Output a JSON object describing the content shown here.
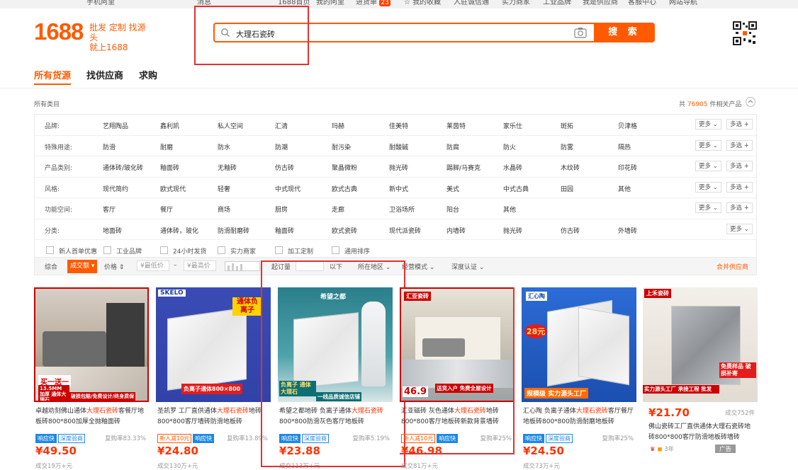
{
  "topbar": {
    "items": [
      "手机阿里",
      "消息",
      "1688首页",
      "我的阿里",
      "进货单",
      "我的收藏",
      "入驻诚信通",
      "实力商家",
      "工业品牌",
      "我是供应商",
      "客服中心",
      "网站导航"
    ],
    "cart_count": "23"
  },
  "header": {
    "logo": "1688",
    "slogan_line1": "批发 定制 找源头",
    "slogan_line2": "就上1688",
    "search_value": "大理石瓷砖",
    "search_button": "搜 索"
  },
  "tabs": [
    {
      "label": "所有货源",
      "active": true
    },
    {
      "label": "找供应商",
      "active": false
    },
    {
      "label": "求购",
      "active": false
    }
  ],
  "category": {
    "all_label": "所有类目",
    "count_prefix": "共",
    "count": "76905",
    "count_suffix": "件相关产品"
  },
  "filters": [
    {
      "label": "品牌:",
      "options": [
        "艺翔陶品",
        "鑫利凯",
        "私人空间",
        "汇清",
        "玛赫",
        "佳美特",
        "莱茵特",
        "家乐仕",
        "斑拓",
        "贝津格"
      ]
    },
    {
      "label": "特殊用途:",
      "options": [
        "防滑",
        "耐磨",
        "防水",
        "防潮",
        "耐污染",
        "耐酸碱",
        "防腐",
        "防火",
        "防雾",
        "隔热"
      ]
    },
    {
      "label": "产品类别:",
      "options": [
        "通体砖/玻化砖",
        "釉面砖",
        "无釉砖",
        "仿古砖",
        "聚晶微粉",
        "抛光砖",
        "踢脚/马赛克",
        "水晶砖",
        "木纹砖",
        "印花砖"
      ]
    },
    {
      "label": "风格:",
      "options": [
        "现代简约",
        "欧式现代",
        "轻奢",
        "中式现代",
        "欧式古典",
        "新中式",
        "美式",
        "中式古典",
        "田园",
        "其他"
      ]
    },
    {
      "label": "功能空间:",
      "options": [
        "客厅",
        "餐厅",
        "商场",
        "厨房",
        "走廊",
        "卫浴场所",
        "阳台",
        "其他"
      ]
    },
    {
      "label": "分类:",
      "options": [
        "地面砖",
        "通体砖，玻化",
        "防滑耐磨砖",
        "釉面砖",
        "欧式瓷砖",
        "现代派瓷砖",
        "内墙砖",
        "抛光砖",
        "仿古砖",
        "外墙砖"
      ]
    }
  ],
  "filter_buttons": {
    "more": "更多",
    "multi": "多选"
  },
  "checkboxes": [
    "新人首单优惠",
    "工业品牌",
    "24小时发货",
    "实力商家",
    "加工定制",
    "通用排序"
  ],
  "sort": {
    "items": [
      "综合",
      "成交额",
      "价格"
    ],
    "min_price": "¥最低价",
    "dash": "–",
    "max_price": "¥最高价",
    "moq": "起订量",
    "below": "以下",
    "region": "所在地区",
    "mode": "经营模式",
    "cert": "深度认证",
    "merge": "合并供应商"
  },
  "products": [
    {
      "title_pre": "卓越劝刻佛山通体",
      "title_hl": "大理石瓷砖",
      "title_post": "客餐厅地板砖800*800加厚全抛釉面砖",
      "tags": [
        "响应快",
        "深度验商"
      ],
      "rate": "复购率83.33%",
      "price": "¥49.50",
      "sold": "成交19万+元",
      "img_text1": "买一送一",
      "img_text2": "13.5MM 加厚 通体大理石",
      "img_text3": "破损包赔/免费设计/终身质保"
    },
    {
      "title_pre": "圣凯罗 工厂直供通体",
      "title_hl": "大理石瓷砖",
      "title_post": "地砖800*800客厅墙砖防滑地板砖",
      "tags": [
        "新人减10元",
        "响应快"
      ],
      "rate": "复购率13.89%",
      "price": "¥24.80",
      "sold": "成交130万+元",
      "img_text1": "SKELO",
      "img_text2": "通体负离子",
      "img_text3": "负离子通体800×800"
    },
    {
      "title_pre": "希望之都地砖 负离子通体",
      "title_hl": "大理石瓷砖",
      "title_post": "800*800防滑灰色客厅地板砖",
      "tags": [
        "响应快",
        "深度验商"
      ],
      "rate": "复购率5.19%",
      "price": "¥23.88",
      "sold": "成交113万+元",
      "img_text1": "希望之都",
      "img_text2": "负离子 通体大理石",
      "img_text3": "一线品质诚信店铺"
    },
    {
      "title_pre": "汇亚磁砖 灰色通体",
      "title_hl": "大理石瓷砖",
      "title_post": "地砖800*800客厅地板砖新款背景墙砖",
      "tags": [
        "新人减10元",
        "响应快"
      ],
      "rate": "复购率25%",
      "price": "¥46.98",
      "sold": "成交81万+元",
      "img_text1": "汇亚瓷砖",
      "img_text2": "46.9",
      "img_text3": "送货入户 免费全屋设计"
    },
    {
      "title_pre": "汇心陶 负离子通体",
      "title_hl": "大理石瓷砖",
      "title_post": "客厅餐厅地板砖800*800防滑耐磨地板砖",
      "tags": [
        "响应快",
        "深度验商"
      ],
      "rate": "复购率25%",
      "price": "¥24.50",
      "sold": "成交73万+元",
      "img_text1": "汇心陶",
      "img_text2": "28元",
      "img_text3": "规模级 实力源头工厂"
    },
    {
      "title_pre": "佛山瓷砖工厂直供通体大理石瓷砖地砖800*800客厅防滑地板砖墙砖",
      "title_hl": "",
      "title_post": "",
      "tags": [],
      "rate": "成交752件",
      "price": "¥21.70",
      "sold": "3年",
      "img_text1": "上禾瓷砖",
      "img_text2": "免费样品 破损补寄",
      "img_text3": "实力源头工厂 承接工程 批发",
      "ad": "广告"
    }
  ]
}
